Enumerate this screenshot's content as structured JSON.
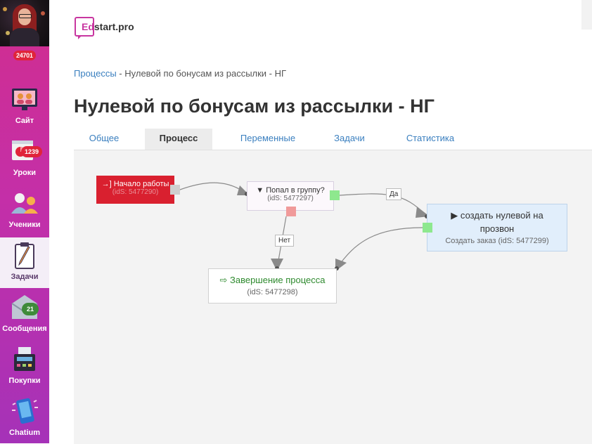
{
  "sidebar": {
    "top_badge": "24701",
    "items": [
      {
        "label": "Сайт",
        "icon": "site-screen-icon"
      },
      {
        "label": "Уроки",
        "icon": "lessons-board-icon",
        "badge": "1239"
      },
      {
        "label": "Ученики",
        "icon": "students-icon"
      },
      {
        "label": "Задачи",
        "icon": "tasks-clipboard-icon"
      },
      {
        "label": "Сообщения",
        "icon": "messages-envelope-icon",
        "badge": "21"
      },
      {
        "label": "Покупки",
        "icon": "purchases-register-icon"
      },
      {
        "label": "Chatium",
        "icon": "chatium-phone-icon"
      }
    ]
  },
  "logo": {
    "first": "Ed",
    "rest": "start.pro"
  },
  "breadcrumb": {
    "link": "Процессы",
    "separator": " - ",
    "current": "Нулевой по бонусам из рассылки - НГ"
  },
  "title": "Нулевой по бонусам из рассылки - НГ",
  "tabs": [
    "Общее",
    "Процесс",
    "Переменные",
    "Задачи",
    "Статистика"
  ],
  "active_tab": "Процесс",
  "flow": {
    "start": {
      "icon": "sign-in-icon",
      "label": "Начало работы",
      "sub": "(idS: 5477290)"
    },
    "filter": {
      "icon": "filter-icon",
      "label": "Попал в группу?",
      "sub": "(idS: 5477297)"
    },
    "action": {
      "icon": "play-icon",
      "label_line1": "создать нулевой на",
      "label_line2": "прозвон",
      "sub": "Создать заказ (idS: 5477299)"
    },
    "end": {
      "icon": "exit-icon",
      "label": "Завершение процесса",
      "sub": "(idS: 5477298)"
    },
    "yes_label": "Да",
    "no_label": "Нет"
  },
  "colors": {
    "accent": "#c836a0",
    "link": "#3a7fbf",
    "start_node": "#d9202f",
    "port_yes": "#8ee88e",
    "port_no": "#f09a9a"
  }
}
